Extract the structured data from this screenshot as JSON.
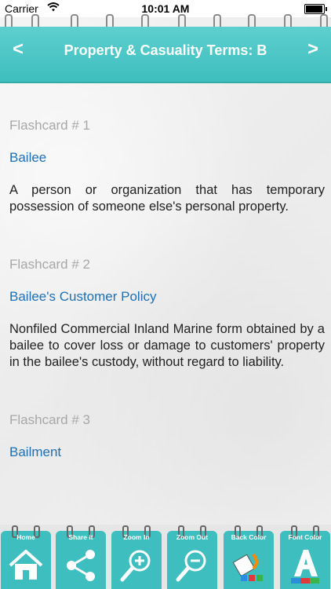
{
  "status": {
    "carrier": "Carrier",
    "time": "10:01 AM",
    "battery_level": 0.9
  },
  "nav": {
    "title": "Property & Casuality Terms: B",
    "prev_icon": "<",
    "next_icon": ">"
  },
  "cards": [
    {
      "number": "Flashcard # 1",
      "term": "Bailee",
      "definition": "A person or organization that has temporary possession of someone else's personal property."
    },
    {
      "number": "Flashcard # 2",
      "term": "Bailee's Customer Policy",
      "definition": "Nonfiled Commercial Inland Marine form obtained by a bailee to cover loss or damage to customers' property in the bailee's custody, without regard to liability."
    },
    {
      "number": "Flashcard # 3",
      "term": "Bailment",
      "definition": ""
    }
  ],
  "toolbar": {
    "home": "Home",
    "share": "Share it",
    "zoom_in": "Zoom In",
    "zoom_out": "Zoom Out",
    "back_color": "Back Color",
    "font_color": "Font Color"
  },
  "colors": {
    "accent": "#3ebebe",
    "term_link": "#1f6fb2",
    "muted": "#a8a8a8"
  }
}
